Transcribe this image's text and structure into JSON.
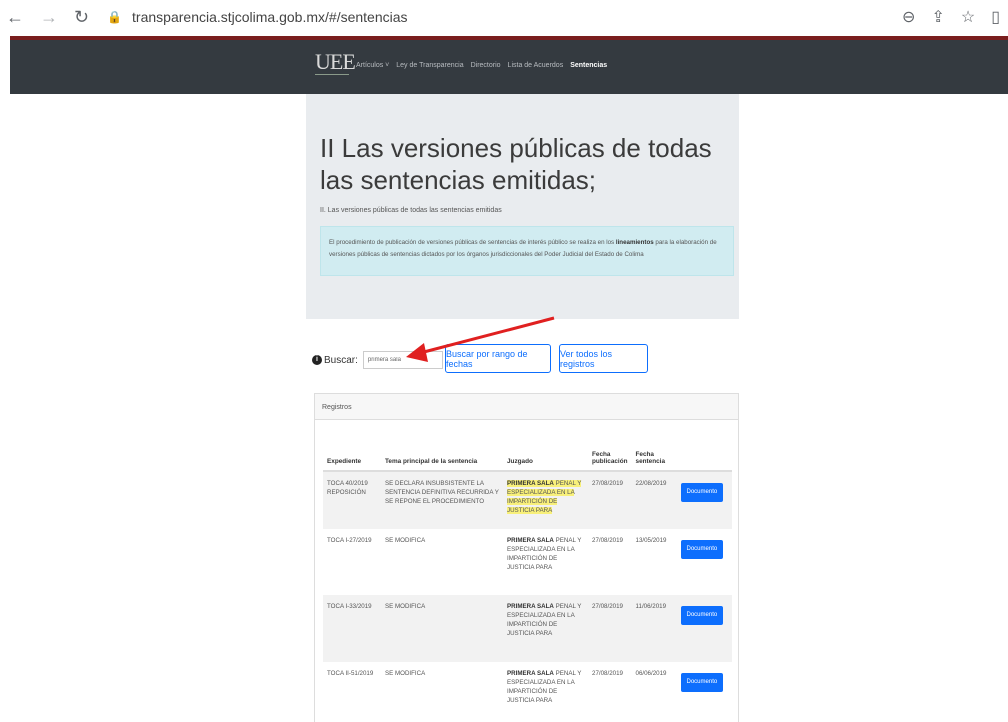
{
  "browser": {
    "url": "transparencia.stjcolima.gob.mx/#/sentencias"
  },
  "navbar": {
    "logo_text": "UEE",
    "menu": [
      "Artículos ˅",
      "Ley de Transparencia",
      "Directorio",
      "Lista de Acuerdos",
      "Sentencias"
    ]
  },
  "hero": {
    "title": "II Las versiones públicas de todas las sentencias emitidas;",
    "lead": "II. Las versiones públicas de todas las sentencias emitidas",
    "info_pre": "El procedimiento de publicación de versiones públicas de sentencias de interés público se realiza en los ",
    "info_bold": "lineamientos",
    "info_post": " para la elaboración de versiones públicas de sentencias dictados por los órganos jurisdiccionales del Poder Judicial del Estado de Colima"
  },
  "search": {
    "label": "Buscar:",
    "value": "primera sala",
    "btn_range": "Buscar por rango de fechas",
    "btn_all": "Ver todos los registros"
  },
  "card": {
    "header": "Registros"
  },
  "table": {
    "headers": [
      "Expediente",
      "Tema principal de la sentencia",
      "Juzgado",
      "Fecha publicación",
      "Fecha sentencia"
    ],
    "doc_label": "Documento",
    "rows": [
      {
        "exp": "TOCA 40/2019 REPOSICIÓN",
        "tema": "SE DECLARA INSUBSISTENTE LA SENTENCIA DEFINITIVA RECURRIDA Y SE REPONE EL PROCEDIMIENTO",
        "juz_bold": "PRIMERA SALA",
        "juz_rest": " PENAL Y ESPECIALIZADA EN LA IMPARTICIÓN DE JUSTICIA PARA",
        "pub": "27/08/2019",
        "sent": "22/08/2019"
      },
      {
        "exp": "TOCA I-27/2019",
        "tema": "SE MODIFICA",
        "juz_bold": "PRIMERA SALA",
        "juz_rest": " PENAL Y ESPECIALIZADA EN LA IMPARTICIÓN DE JUSTICIA PARA",
        "pub": "27/08/2019",
        "sent": "13/05/2019"
      },
      {
        "exp": "TOCA I-33/2019",
        "tema": "SE MODIFICA",
        "juz_bold": "PRIMERA SALA",
        "juz_rest": " PENAL Y ESPECIALIZADA EN LA IMPARTICIÓN DE JUSTICIA PARA",
        "pub": "27/08/2019",
        "sent": "11/06/2019"
      },
      {
        "exp": "TOCA II-51/2019",
        "tema": "SE MODIFICA",
        "juz_bold": "PRIMERA SALA",
        "juz_rest": " PENAL Y ESPECIALIZADA EN LA IMPARTICIÓN DE JUSTICIA PARA",
        "pub": "27/08/2019",
        "sent": "06/06/2019"
      }
    ]
  },
  "colors": {
    "navbar": "#343a40",
    "accent": "#0d6efd",
    "highlight": "#f8f07a",
    "arrow": "#e02020"
  }
}
